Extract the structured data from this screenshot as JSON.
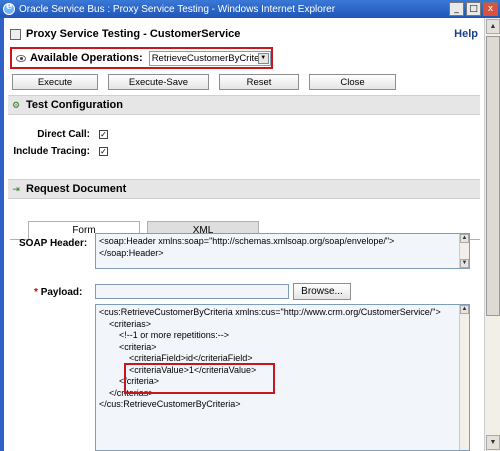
{
  "window": {
    "title": "Oracle Service Bus : Proxy Service Testing - Windows Internet Explorer",
    "min": "_",
    "max": "□",
    "close": "x"
  },
  "header": {
    "title": "Proxy Service Testing - CustomerService",
    "help": "Help"
  },
  "operations": {
    "label": "Available Operations:",
    "selected": "RetrieveCustomerByCriteria"
  },
  "buttons": {
    "execute": "Execute",
    "execute_save": "Execute-Save",
    "reset": "Reset",
    "close": "Close"
  },
  "test_config": {
    "title": "Test Configuration",
    "direct_call": "Direct Call:",
    "include_tracing": "Include Tracing:",
    "direct_call_checked": true,
    "include_tracing_checked": true,
    "checkmark": "✓"
  },
  "request": {
    "title": "Request Document",
    "tabs": [
      "Form",
      "XML"
    ],
    "soap_header_label": "SOAP Header:",
    "soap_header_lines": [
      "<soap:Header xmlns:soap=\"http://schemas.xmlsoap.org/soap/envelope/\">",
      "</soap:Header>"
    ],
    "payload_required": "*",
    "payload_label": "Payload:",
    "browse": "Browse...",
    "payload_lines": [
      "<cus:RetrieveCustomerByCriteria xmlns:cus=\"http://www.crm.org/CustomerService/\">",
      "    <criterias>",
      "        <!--1 or more repetitions:-->",
      "        <criteria>",
      "            <criteriaField>id</criteriaField>",
      "            <criteriaValue>1</criteriaValue>",
      "        </criteria>",
      "    </criterias>",
      "</cus:RetrieveCustomerByCriteria>"
    ]
  }
}
